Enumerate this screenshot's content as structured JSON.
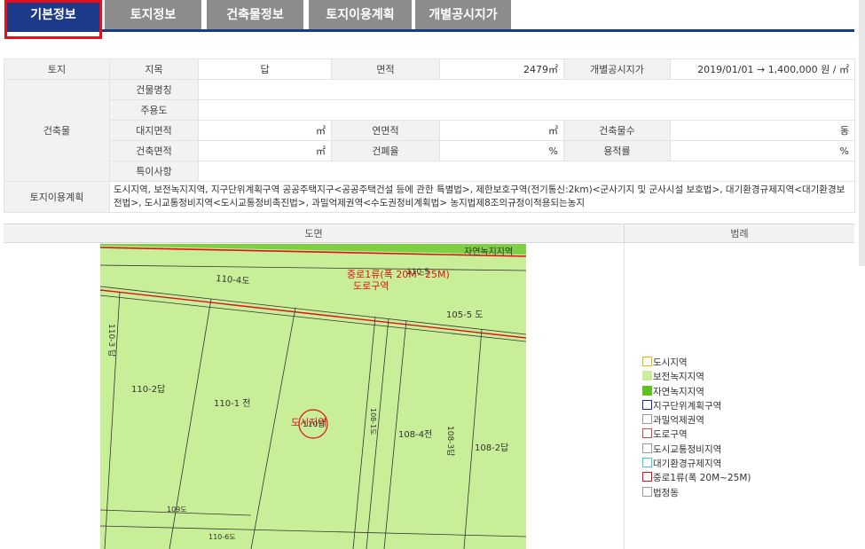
{
  "tabs": [
    {
      "label": "기본정보",
      "active": true
    },
    {
      "label": "토지정보",
      "active": false
    },
    {
      "label": "건축물정보",
      "active": false
    },
    {
      "label": "토지이용계획",
      "active": false
    },
    {
      "label": "개별공시지가",
      "active": false
    }
  ],
  "info": {
    "land_header": "토지",
    "jimok_label": "지목",
    "jimok_value": "답",
    "area_label": "면적",
    "area_value": "2479㎡",
    "price_label": "개별공시지가",
    "price_value": "2019/01/01 → 1,400,000 원 / ㎡",
    "building_header": "건축물",
    "bldg_name_label": "건물명칭",
    "main_use_label": "주용도",
    "site_area_label": "대지면적",
    "site_area_unit": "㎡",
    "floor_area_label": "연면적",
    "floor_area_unit": "㎡",
    "floors_label": "건축물수",
    "floors_unit": "동",
    "build_area_label": "건축면적",
    "build_area_unit": "㎡",
    "bcr_label": "건폐율",
    "bcr_unit": "%",
    "far_label": "용적률",
    "far_unit": "%",
    "special_label": "특이사항",
    "plan_header": "토지이용계획",
    "plan_text": "도시지역, 보전녹지지역, 지구단위계획구역 공공주택지구<공공주택건설 등에 관한 특별법>, 제한보호구역(전기통신:2km)<군사기지 및 군사시설 보호법>, 대기환경규제지역<대기환경보전법>, 도시교통정비지역<도시교통정비촉진법>, 과밀억제권역<수도권정비계획법> 농지법제8조의규정이적용되는농지"
  },
  "map_header": "도면",
  "legend_header": "범례",
  "map_labels": {
    "zone_top": "자연녹지지역",
    "road_class": "중로1류(폭 20M~25M)",
    "road_zone": "도로구역",
    "p_110_4": "110-4도",
    "p_110_5": "110-5",
    "p_105_5": "105-5 도",
    "p_110_3": "110-3 답",
    "p_110_2": "110-2답",
    "p_110_1": "110-1 전",
    "p_110": "110답",
    "p_city": "도시지역",
    "p_108_4": "108-4전",
    "p_108_3": "108-3답",
    "p_108_2": "108-2답",
    "p_109": "109도",
    "p_bottom": "110-6도",
    "p_mid": "108-1도"
  },
  "legend": [
    {
      "label": "도시지역",
      "fill": "#ffffff",
      "border": "#d8c200"
    },
    {
      "label": "보전녹지지역",
      "fill": "#c9ef9a",
      "border": "#c9ef9a"
    },
    {
      "label": "자연녹지지역",
      "fill": "#5ec21e",
      "border": "#5ec21e"
    },
    {
      "label": "지구단위계획구역",
      "fill": "#ffffff",
      "border": "#1a2a9c"
    },
    {
      "label": "과밀억제권역",
      "fill": "#ffffff",
      "border": "#999999"
    },
    {
      "label": "도로구역",
      "fill": "#ffffff",
      "border": "#c05050"
    },
    {
      "label": "도시교통정비지역",
      "fill": "#ffffff",
      "border": "#999999"
    },
    {
      "label": "대기환경규제지역",
      "fill": "#ffffff",
      "border": "#40c8d8"
    },
    {
      "label": "중로1류(폭 20M~25M)",
      "fill": "#ffffff",
      "border": "#e0101a"
    },
    {
      "label": "법정동",
      "fill": "#ffffff",
      "border": "#999999"
    }
  ]
}
